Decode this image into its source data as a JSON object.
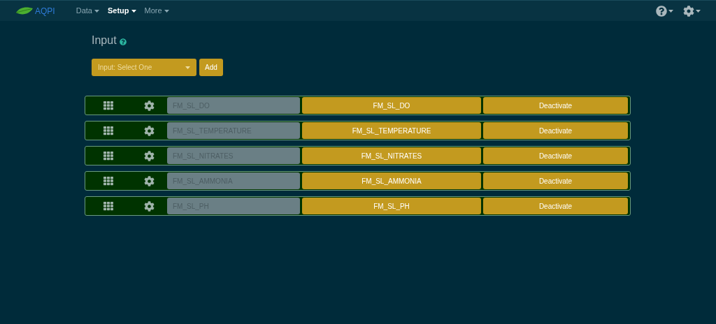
{
  "brand": "AQPI",
  "nav": [
    {
      "label": "Data",
      "selected": false
    },
    {
      "label": "Setup",
      "selected": true
    },
    {
      "label": "More",
      "selected": false
    }
  ],
  "page": {
    "title": "Input",
    "select": "Input: Select One",
    "add_button": "Add"
  },
  "inputs": [
    {
      "placeholder": "FM_SL_DO",
      "name": "FM_SL_DO",
      "action": "Deactivate"
    },
    {
      "placeholder": "FM_SL_TEMPERATURE",
      "name": "FM_SL_TEMPERATURE",
      "action": "Deactivate"
    },
    {
      "placeholder": "FM_SL_NITRATES",
      "name": "FM_SL_NITRATES",
      "action": "Deactivate"
    },
    {
      "placeholder": "FM_SL_AMMONIA",
      "name": "FM_SL_AMMONIA",
      "action": "Deactivate"
    },
    {
      "placeholder": "FM_SL_PH",
      "name": "FM_SL_PH",
      "action": "Deactivate"
    }
  ]
}
